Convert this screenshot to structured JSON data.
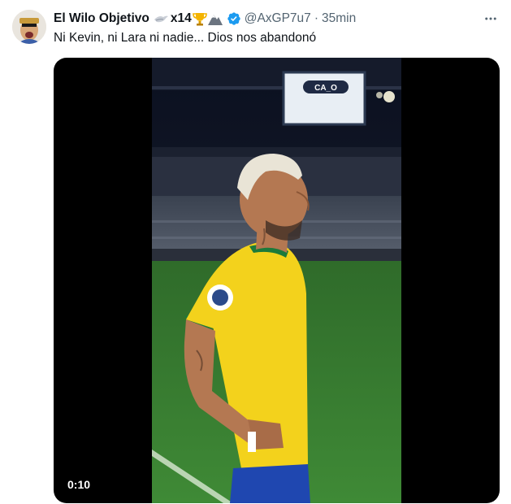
{
  "tweet": {
    "display_name": "El Wilo Objetivo",
    "badge_count": "x14",
    "handle": "@AxGP7u7",
    "separator": "·",
    "time": "35min",
    "text": "Ni Kevin, ni Lara ni nadie... Dios nos abandonó",
    "verified_color": "#1d9bf0"
  },
  "video": {
    "duration": "0:10",
    "scoreboard_text": "CA_O"
  },
  "icons": {
    "more": "more-options-icon",
    "verified": "verified-badge-icon",
    "bird": "bird-emoji-icon",
    "trophy": "trophy-emoji-icon",
    "mountain": "mountain-emoji-icon"
  }
}
